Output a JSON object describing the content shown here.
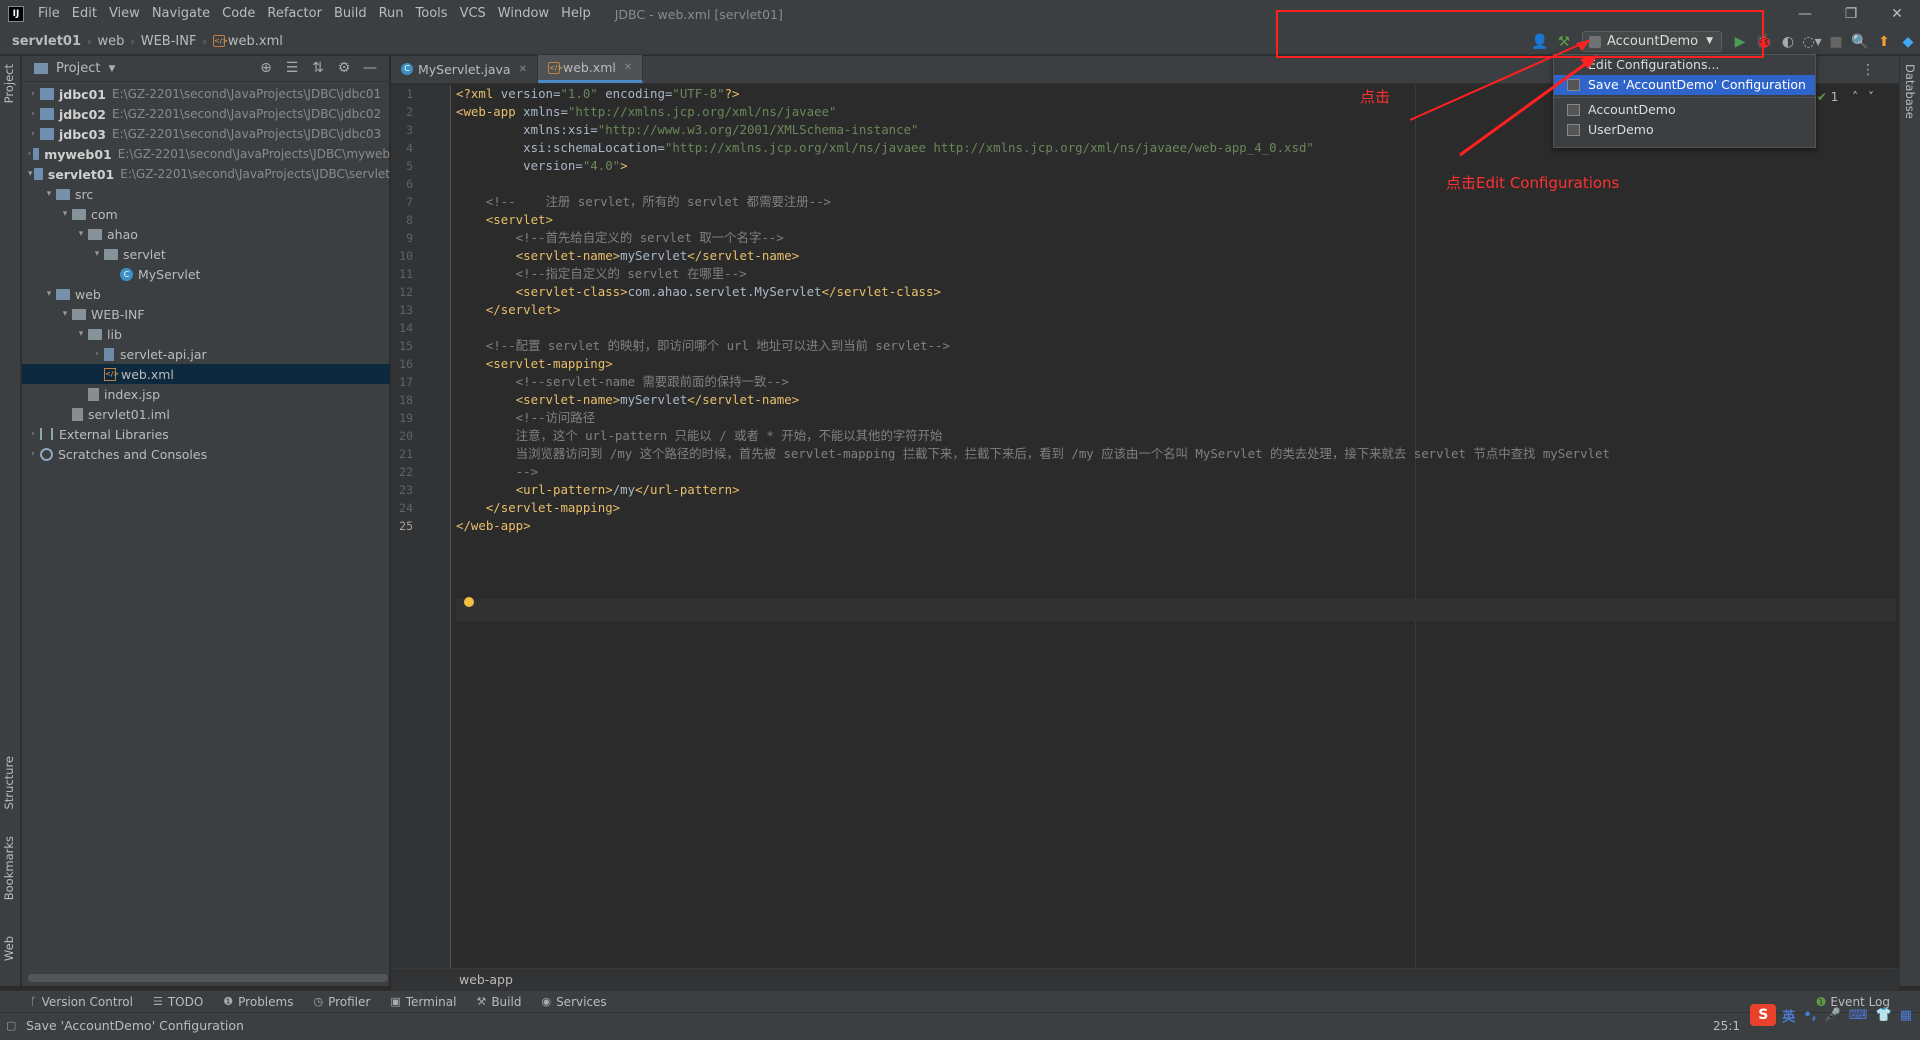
{
  "window": {
    "title": "JDBC - web.xml [servlet01]",
    "menus": [
      "File",
      "Edit",
      "View",
      "Navigate",
      "Code",
      "Refactor",
      "Build",
      "Run",
      "Tools",
      "VCS",
      "Window",
      "Help"
    ],
    "controls": [
      "—",
      "❐",
      "✕"
    ]
  },
  "breadcrumb": [
    "servlet01",
    "web",
    "WEB-INF",
    "web.xml"
  ],
  "toolbar": {
    "run_config": "AccountDemo"
  },
  "run_popup": {
    "items": [
      {
        "label": "Edit Configurations...",
        "selected": false
      },
      {
        "label": "Save 'AccountDemo' Configuration",
        "selected": true
      },
      {
        "label": "AccountDemo",
        "selected": false
      },
      {
        "label": "UserDemo",
        "selected": false
      }
    ]
  },
  "left_tabs": [
    "Project",
    "Structure",
    "Bookmarks",
    "Web"
  ],
  "right_tabs": [
    "Database"
  ],
  "project": {
    "title": "Project",
    "tree": [
      {
        "label": "jdbc01",
        "path": "E:\\GZ-2201\\second\\JavaProjects\\JDBC\\jdbc01",
        "depth": 0,
        "arrow": "right",
        "icon": "module",
        "bold": true
      },
      {
        "label": "jdbc02",
        "path": "E:\\GZ-2201\\second\\JavaProjects\\JDBC\\jdbc02",
        "depth": 0,
        "arrow": "right",
        "icon": "module",
        "bold": true
      },
      {
        "label": "jdbc03",
        "path": "E:\\GZ-2201\\second\\JavaProjects\\JDBC\\jdbc03",
        "depth": 0,
        "arrow": "right",
        "icon": "module",
        "bold": true
      },
      {
        "label": "myweb01",
        "path": "E:\\GZ-2201\\second\\JavaProjects\\JDBC\\myweb",
        "depth": 0,
        "arrow": "right",
        "icon": "module",
        "bold": true
      },
      {
        "label": "servlet01",
        "path": "E:\\GZ-2201\\second\\JavaProjects\\JDBC\\servlet",
        "depth": 0,
        "arrow": "down",
        "icon": "module",
        "bold": true
      },
      {
        "label": "src",
        "path": "",
        "depth": 1,
        "arrow": "down",
        "icon": "folder-blue",
        "bold": false
      },
      {
        "label": "com",
        "path": "",
        "depth": 2,
        "arrow": "down",
        "icon": "folder",
        "bold": false
      },
      {
        "label": "ahao",
        "path": "",
        "depth": 3,
        "arrow": "down",
        "icon": "folder",
        "bold": false
      },
      {
        "label": "servlet",
        "path": "",
        "depth": 4,
        "arrow": "down",
        "icon": "folder",
        "bold": false
      },
      {
        "label": "MyServlet",
        "path": "",
        "depth": 5,
        "arrow": "",
        "icon": "class",
        "bold": false
      },
      {
        "label": "web",
        "path": "",
        "depth": 1,
        "arrow": "down",
        "icon": "folder-blue",
        "bold": false
      },
      {
        "label": "WEB-INF",
        "path": "",
        "depth": 2,
        "arrow": "down",
        "icon": "folder",
        "bold": false
      },
      {
        "label": "lib",
        "path": "",
        "depth": 3,
        "arrow": "down",
        "icon": "folder",
        "bold": false
      },
      {
        "label": "servlet-api.jar",
        "path": "",
        "depth": 4,
        "arrow": "right",
        "icon": "jar",
        "bold": false
      },
      {
        "label": "web.xml",
        "path": "",
        "depth": 4,
        "arrow": "",
        "icon": "xml",
        "bold": false,
        "selected": true
      },
      {
        "label": "index.jsp",
        "path": "",
        "depth": 3,
        "arrow": "",
        "icon": "file",
        "bold": false
      },
      {
        "label": "servlet01.iml",
        "path": "",
        "depth": 2,
        "arrow": "",
        "icon": "file",
        "bold": false
      },
      {
        "label": "External Libraries",
        "path": "",
        "depth": 0,
        "arrow": "right",
        "icon": "lib",
        "bold": false
      },
      {
        "label": "Scratches and Consoles",
        "path": "",
        "depth": 0,
        "arrow": "right",
        "icon": "scratch",
        "bold": false
      }
    ]
  },
  "editor": {
    "tabs": [
      {
        "label": "MyServlet.java",
        "active": false
      },
      {
        "label": "web.xml",
        "active": true
      }
    ],
    "current_line": 25,
    "inspection": "1",
    "lines": [
      "<?xml version=\"1.0\" encoding=\"UTF-8\"?>",
      "<web-app xmlns=\"http://xmlns.jcp.org/xml/ns/javaee\"",
      "         xmlns:xsi=\"http://www.w3.org/2001/XMLSchema-instance\"",
      "         xsi:schemaLocation=\"http://xmlns.jcp.org/xml/ns/javaee http://xmlns.jcp.org/xml/ns/javaee/web-app_4_0.xsd\"",
      "         version=\"4.0\">",
      "",
      "    <!--    注册 servlet，所有的 servlet 都需要注册-->",
      "    <servlet>",
      "        <!--首先给自定义的 servlet 取一个名字-->",
      "        <servlet-name>myServlet</servlet-name>",
      "        <!--指定自定义的 servlet 在哪里-->",
      "        <servlet-class>com.ahao.servlet.MyServlet</servlet-class>",
      "    </servlet>",
      "",
      "    <!--配置 servlet 的映射，即访问哪个 url 地址可以进入到当前 servlet-->",
      "    <servlet-mapping>",
      "        <!--servlet-name 需要跟前面的保持一致-->",
      "        <servlet-name>myServlet</servlet-name>",
      "        <!--访问路径",
      "        注意，这个 url-pattern 只能以 / 或者 * 开始，不能以其他的字符开始",
      "        当浏览器访问到 /my 这个路径的时候，首先被 servlet-mapping 拦截下来，拦截下来后，看到 /my 应该由一个名叫 MyServlet 的类去处理，接下来就去 servlet 节点中查找 myServlet",
      "        -->",
      "        <url-pattern>/my</url-pattern>",
      "    </servlet-mapping>",
      "</web-app>"
    ],
    "bottom_breadcrumb": "web-app"
  },
  "bottom_tools": [
    "Version Control",
    "TODO",
    "Problems",
    "Profiler",
    "Terminal",
    "Build",
    "Services"
  ],
  "event_log": "Event Log",
  "status": {
    "message": "Save 'AccountDemo' Configuration",
    "position": "25:1"
  },
  "ime": {
    "logo": "S",
    "items": [
      "英",
      "•,",
      "🎤",
      "⌨",
      "👕",
      "▦"
    ]
  },
  "annotations": {
    "click": "点击",
    "click_edit": "点击Edit Configurations"
  }
}
